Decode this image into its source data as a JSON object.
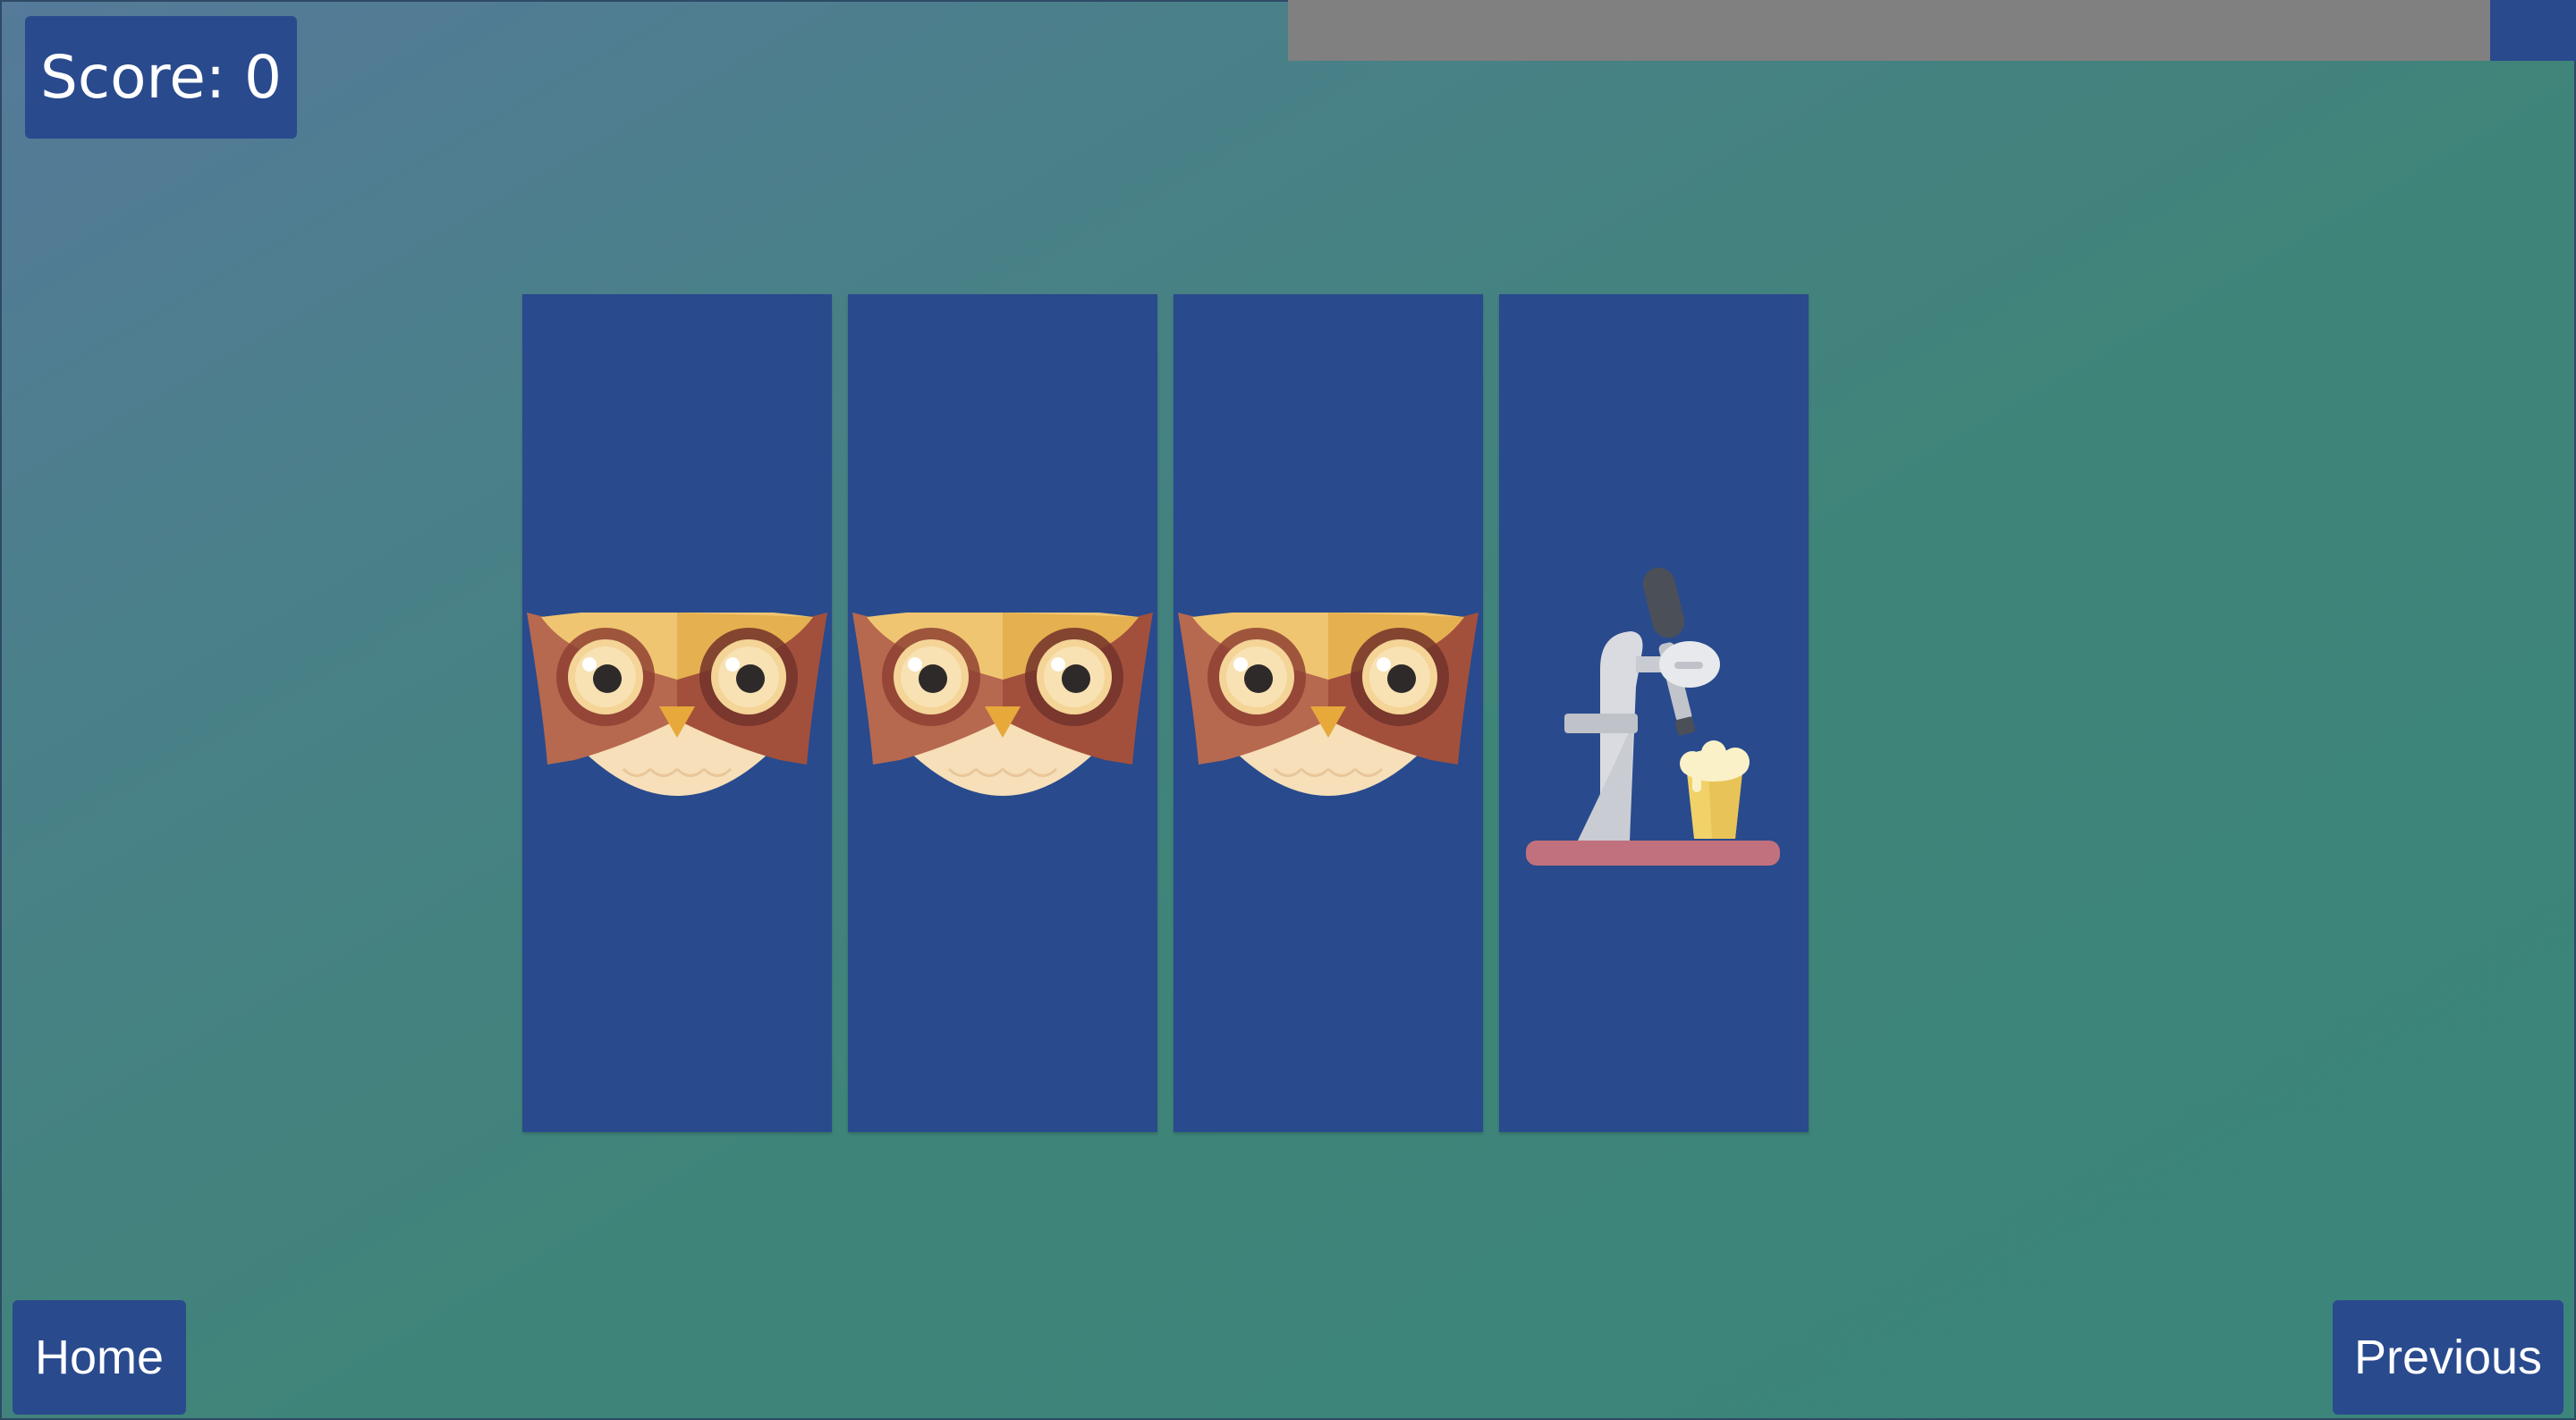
{
  "score": {
    "text": "Score: 0"
  },
  "progress": {
    "fraction": 0.0667
  },
  "cards": [
    {
      "icon": "owl-icon"
    },
    {
      "icon": "owl-icon"
    },
    {
      "icon": "owl-icon"
    },
    {
      "icon": "beer-tap-icon"
    }
  ],
  "nav": {
    "home_label": "Home",
    "previous_label": "Previous"
  },
  "colors": {
    "accent": "#294a8d",
    "progress_track": "#808080"
  }
}
